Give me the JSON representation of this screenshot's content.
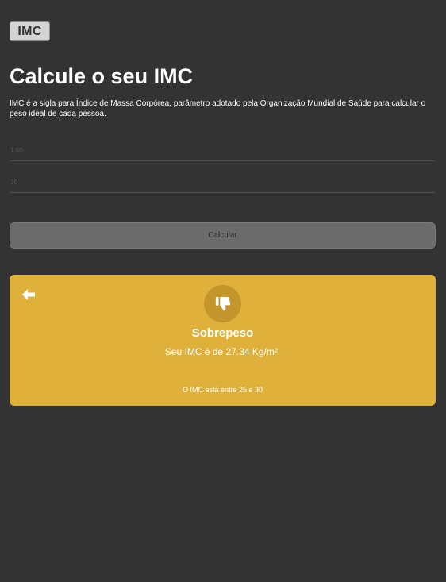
{
  "header": {
    "logo_text": "IMC"
  },
  "main": {
    "title": "Calcule o seu IMC",
    "description": "IMC é a sigla para Índice de Massa Corpórea, parâmetro adotado pela Organização Mundial de Saúde para calcular o peso ideal de cada pessoa."
  },
  "form": {
    "height_placeholder": "1.60",
    "weight_placeholder": "70",
    "calculate_label": "Calcular"
  },
  "result": {
    "icon": "thumbs-down-icon",
    "back_icon": "arrow-left-icon",
    "status": "Sobrepeso",
    "value_text": "Seu IMC é de 27.34 Kg/m².",
    "range_text": "O IMC está entre 25 e 30"
  },
  "colors": {
    "background": "#333333",
    "result_card": "#e0b13a",
    "button": "#6b6b6b"
  }
}
